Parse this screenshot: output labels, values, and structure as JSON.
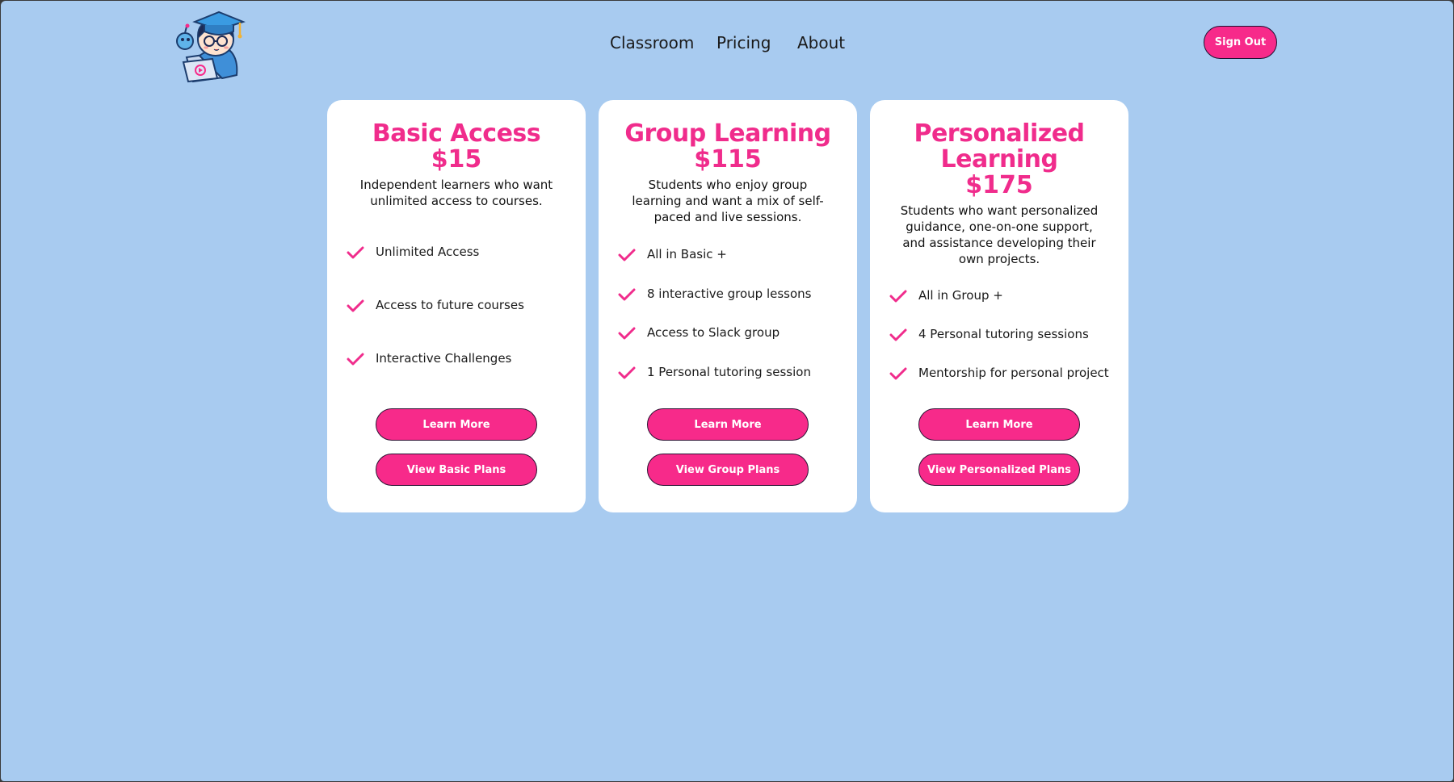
{
  "header": {
    "logo_alt": "student mascot logo",
    "nav": {
      "classroom": "Classroom",
      "pricing": "Pricing",
      "about": "About"
    },
    "sign_out": "Sign Out"
  },
  "colors": {
    "background": "#a8cbf0",
    "accent": "#f72a8a",
    "card": "#ffffff"
  },
  "plans": [
    {
      "title": "Basic Access",
      "price": "$15",
      "description": "Independent learners who want unlimited access to courses.",
      "features": [
        "Unlimited Access",
        "Access to future courses",
        "Interactive Challenges"
      ],
      "learn_more": "Learn More",
      "view_plans": "View Basic Plans"
    },
    {
      "title": "Group Learning",
      "price": "$115",
      "description": "Students who enjoy group learning and want a mix of self-paced and live sessions.",
      "features": [
        "All in Basic +",
        "8 interactive group lessons",
        "Access to Slack group",
        "1 Personal tutoring session"
      ],
      "learn_more": "Learn More",
      "view_plans": "View Group Plans"
    },
    {
      "title_line1": "Personalized",
      "title_line2": "Learning",
      "price": "$175",
      "description": "Students who want personalized guidance, one-on-one support, and assistance developing their own projects.",
      "features": [
        "All in Group +",
        "4 Personal tutoring sessions",
        "Mentorship for personal project"
      ],
      "learn_more": "Learn More",
      "view_plans": "View Personalized Plans"
    }
  ]
}
